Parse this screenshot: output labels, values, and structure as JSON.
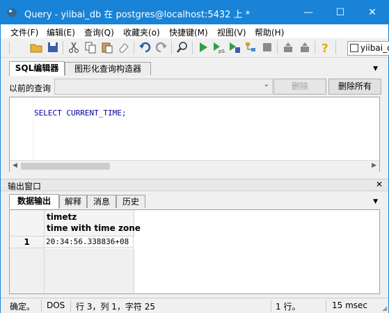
{
  "window": {
    "title": "Query - yiibai_db 在  postgres@localhost:5432 上 *",
    "minimize_glyph": "—",
    "maximize_glyph": "☐",
    "close_glyph": "✕",
    "accent": "#1883d7"
  },
  "menu": [
    {
      "label": "文件(F)"
    },
    {
      "label": "编辑(E)"
    },
    {
      "label": "查询(Q)"
    },
    {
      "label": "收藏夹(o)"
    },
    {
      "label": "快捷键(M)"
    },
    {
      "label": "视图(V)"
    },
    {
      "label": "帮助(H)"
    }
  ],
  "toolbar": {
    "icons": [
      "open-icon",
      "save-icon",
      "cut-icon",
      "copy-icon",
      "paste-icon",
      "eraser-icon",
      "undo-icon",
      "redo-icon",
      "find-icon",
      "execute-icon",
      "execute-pgscript-icon",
      "execute-to-file-icon",
      "explain-icon",
      "stop-icon",
      "vacuum-icon",
      "explain-analyze-icon",
      "help-icon"
    ],
    "database_label": "yiibai_db"
  },
  "editor_tabs": {
    "tabs": [
      "SQL编辑器",
      "图形化查询构造器"
    ],
    "active": 0
  },
  "history": {
    "label": "以前的查询",
    "delete_label": "删除",
    "delete_all_label": "删除所有"
  },
  "editor": {
    "code": "SELECT CURRENT_TIME;"
  },
  "output": {
    "title": "输出窗口",
    "close_glyph": "✕",
    "tabs": [
      "数据输出",
      "解释",
      "消息",
      "历史"
    ],
    "active": 0
  },
  "grid": {
    "columns": [
      {
        "name": "timetz",
        "type": "time with time zone"
      }
    ],
    "rows": [
      {
        "num": "1",
        "values": [
          "20:34:56.338836+08"
        ]
      }
    ]
  },
  "status": {
    "state": "确定。",
    "encoding": "DOS",
    "position": "行 3，列 1，字符 25",
    "rows": "1 行。",
    "time": "15 msec"
  }
}
